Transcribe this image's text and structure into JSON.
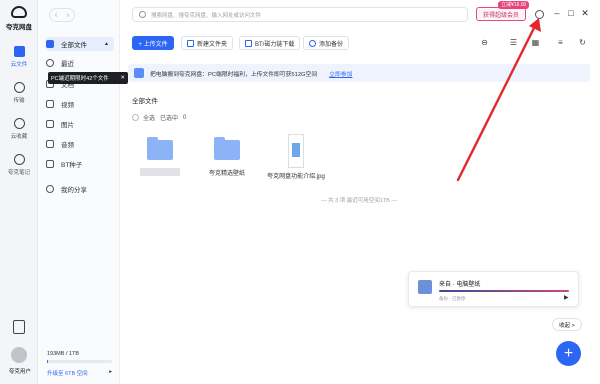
{
  "app": {
    "logo_text": "夸克网盘"
  },
  "rail": {
    "items": [
      {
        "label": "云文件"
      },
      {
        "label": "传输"
      },
      {
        "label": "云收藏"
      },
      {
        "label": "夸克笔记"
      }
    ],
    "user_name": "夸克用户"
  },
  "sidebar": {
    "items": [
      {
        "label": "全部文件"
      },
      {
        "label": "最近"
      },
      {
        "label": "文档"
      },
      {
        "label": "视频"
      },
      {
        "label": "图片"
      },
      {
        "label": "音频"
      },
      {
        "label": "BT种子"
      },
      {
        "label": "我的分享"
      }
    ],
    "tooltip": "PC端近期限时42个文件",
    "storage_text": "193MB / 1TB",
    "storage_fraction": 0.0002,
    "upgrade_text": "升级至 6TB 空间"
  },
  "topbar": {
    "search_placeholder": "搜索网盘、搜夸克网盘、输入网址或访问文件",
    "vip_label": "获得超级会员",
    "vip_badge": "立减¥19.00",
    "min": "–",
    "max": "□",
    "close": "✕"
  },
  "toolbar": {
    "upload": "+ 上传文件",
    "new_folder": "新建文件夹",
    "bt_download": "BT/磁力链下载",
    "add_backup": "添加备份"
  },
  "banner": {
    "text": "把电脑搬到夸克网盘：PC端限时福利，上传文件即可获512G空间",
    "link": "立即参加"
  },
  "content": {
    "section_title": "全部文件",
    "select_all": "全选",
    "selected": "已选中",
    "selected_count": "0",
    "files": [
      {
        "name": "",
        "type": "folder-blurred"
      },
      {
        "name": "夸克精选壁纸",
        "type": "folder"
      },
      {
        "name": "夸克网盘功能介绍.jpg",
        "type": "image"
      }
    ],
    "footer_note": "— 共 3 项 最近可用空间1TB —"
  },
  "player": {
    "title": "来自 · 电脑壁纸",
    "sub": "备份 · 已暂停",
    "play": "▶"
  },
  "collapse_label": "收起 >",
  "fab_label": "+"
}
